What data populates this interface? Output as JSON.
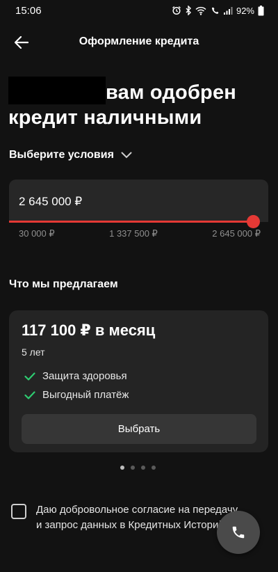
{
  "status_bar": {
    "time": "15:06",
    "battery": "92%"
  },
  "header": {
    "title": "Оформление кредита"
  },
  "hero": {
    "title": "вам одобрен кредит наличными"
  },
  "conditions": {
    "label": "Выберите условия"
  },
  "amount": {
    "value": "2 645 000 ₽",
    "slider_level": 1.0,
    "min_label": "30 000 ₽",
    "mid_label": "1 337 500 ₽",
    "max_label": "2 645 000 ₽"
  },
  "offers": {
    "section_title": "Что мы предлагаем",
    "items": [
      {
        "price": "117 100 ₽ в месяц",
        "term": "5 лет",
        "benefits": [
          "Защита здоровья",
          "Выгодный платёж"
        ],
        "button_label": "Выбрать"
      }
    ],
    "page_count": 4,
    "active_page": 1
  },
  "consent": {
    "text": "Даю добровольное согласие на передачу и запрос данных в Кредитных Историй"
  },
  "colors": {
    "background": "#121212",
    "card": "#242424",
    "accent": "#e53935",
    "check": "#2ecc71"
  }
}
